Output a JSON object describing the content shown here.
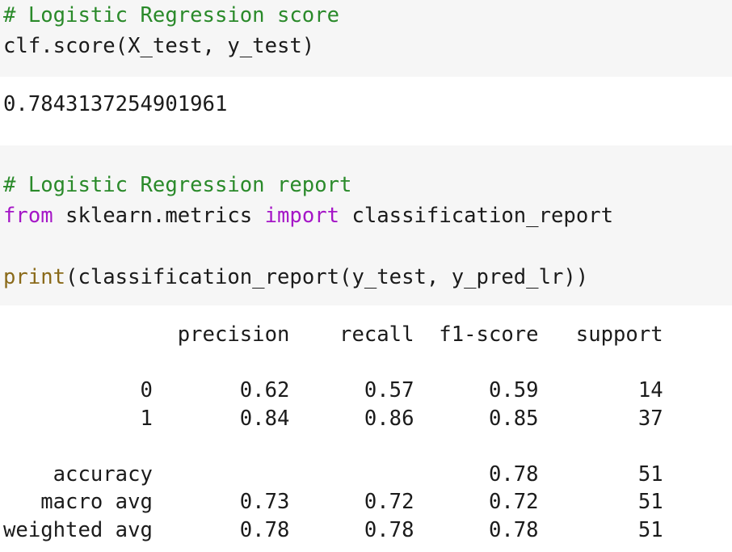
{
  "cells": [
    {
      "input": {
        "comment": "# Logistic Regression score",
        "code": "clf.score(X_test, y_test)"
      },
      "output": "0.7843137254901961"
    },
    {
      "input": {
        "comment": "# Logistic Regression report",
        "import_from": "from",
        "import_module": " sklearn.metrics ",
        "import_kw": "import",
        "import_name": " classification_report",
        "print_fn": "print",
        "print_args": "(classification_report(y_test, y_pred_lr))"
      },
      "output_lines": [
        "              precision    recall  f1-score   support",
        "",
        "           0       0.62      0.57      0.59        14",
        "           1       0.84      0.86      0.85        37",
        "",
        "    accuracy                           0.78        51",
        "   macro avg       0.73      0.72      0.72        51",
        "weighted avg       0.78      0.78      0.78        51"
      ]
    }
  ]
}
